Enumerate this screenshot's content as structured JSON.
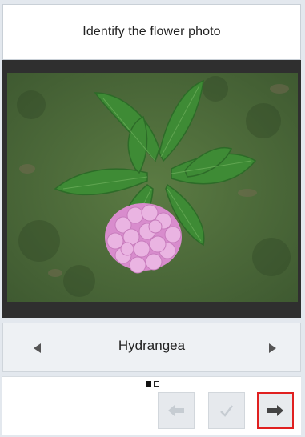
{
  "header": {
    "title": "Identify the flower photo"
  },
  "selector": {
    "name": "Hydrangea"
  },
  "pager": {
    "total": 2,
    "current": 1
  },
  "icons": {
    "prev_option": "left-triangle-icon",
    "next_option": "right-triangle-icon",
    "back": "arrow-left-icon",
    "confirm": "checkmark-icon",
    "forward": "arrow-right-icon"
  },
  "colors": {
    "highlight": "#e02020",
    "photo_frame": "#2f2f2f",
    "flower": "#e6a9dd",
    "leaf": "#3f8a34"
  }
}
